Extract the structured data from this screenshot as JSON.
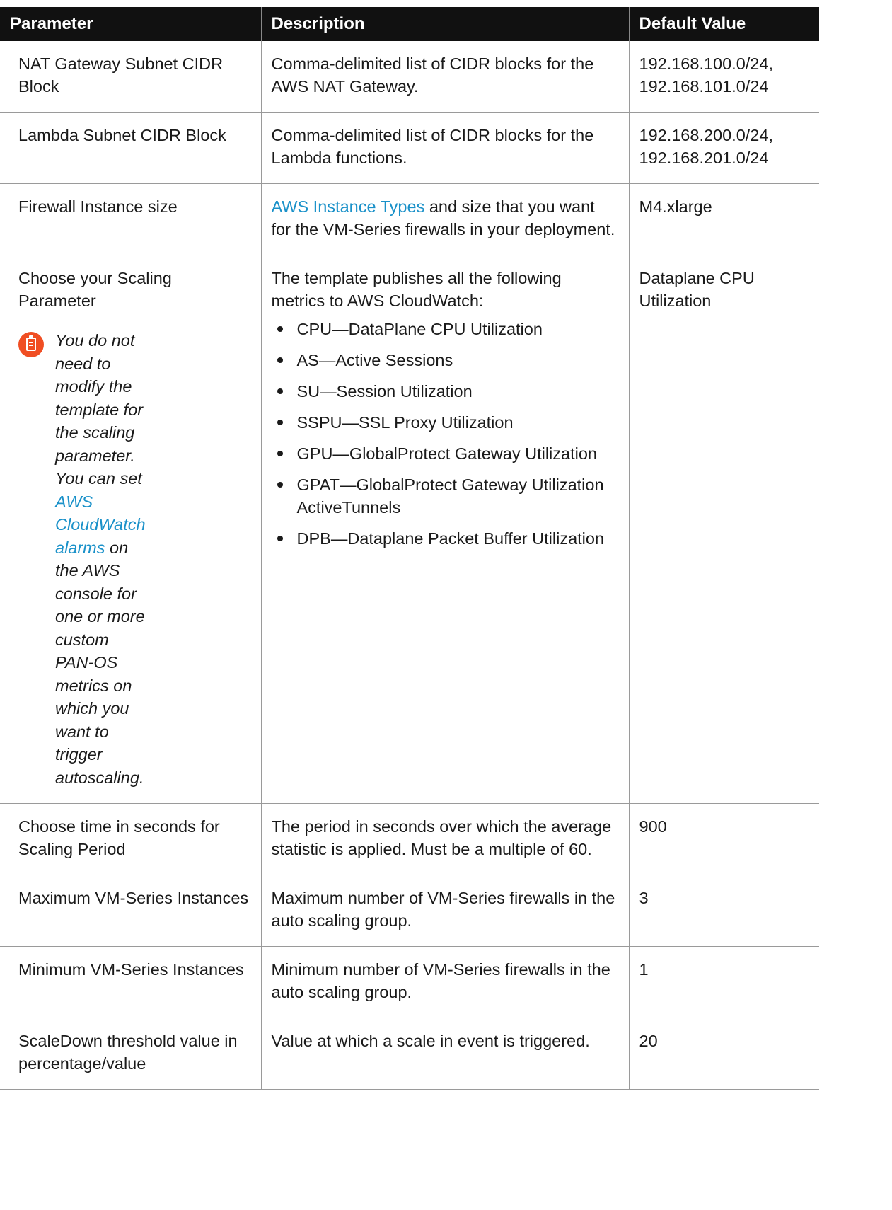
{
  "header": {
    "col1": "Parameter",
    "col2": "Description",
    "col3": "Default Value"
  },
  "rows": [
    {
      "param": "NAT Gateway Subnet CIDR Block",
      "desc": "Comma-delimited list of CIDR blocks for the AWS NAT Gateway.",
      "default": "192.168.100.0/24, 192.168.101.0/24"
    },
    {
      "param": "Lambda Subnet CIDR Block",
      "desc": "Comma-delimited list of CIDR blocks for the Lambda functions.",
      "default": "192.168.200.0/24, 192.168.201.0/24"
    },
    {
      "param": "Firewall Instance size",
      "desc_link": "AWS Instance Types",
      "desc": " and size that you want for the VM-Series firewalls in your deployment.",
      "default": "M4.xlarge"
    },
    {
      "param": "Choose your Scaling Parameter",
      "note": {
        "text_before": "You do not need to modify the template for the scaling parameter. You can set ",
        "link": "AWS CloudWatch alarms",
        "text_after": " on the AWS console for one or more custom PAN-OS metrics on which you want to trigger autoscaling.",
        "icon": "note-clipboard-icon",
        "icon_color": "#f04e23"
      },
      "desc": "The template publishes all the following metrics to AWS CloudWatch:",
      "metrics": [
        "CPU—DataPlane CPU Utilization",
        "AS—Active Sessions",
        "SU—Session Utilization",
        "SSPU—SSL Proxy Utilization",
        "GPU—GlobalProtect Gateway Utilization",
        "GPAT—GlobalProtect Gateway Utilization ActiveTunnels",
        "DPB—Dataplane Packet Buffer Utilization"
      ],
      "default": "Dataplane CPU Utilization"
    },
    {
      "param": "Choose time in seconds for Scaling Period",
      "desc": "The period in seconds over which the average statistic is applied. Must be a multiple of 60.",
      "default": "900"
    },
    {
      "param": "Maximum VM-Series Instances",
      "desc": "Maximum number of VM-Series firewalls in the auto scaling group.",
      "default": "3"
    },
    {
      "param": "Minimum VM-Series Instances",
      "desc": "Minimum number of VM-Series firewalls in the auto scaling group.",
      "default": "1"
    },
    {
      "param": "ScaleDown threshold value in percentage/value",
      "desc": "Value at which a scale in event is triggered.",
      "default": "20"
    }
  ],
  "colors": {
    "header_bg": "#111111",
    "link": "#1a91c9",
    "border": "#9a9a9a"
  }
}
